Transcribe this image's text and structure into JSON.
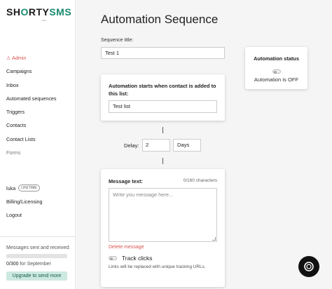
{
  "brand": {
    "name_a": "SH",
    "name_b": "RTY",
    "name_c": "SMS",
    "sub": "beta"
  },
  "sidebar": {
    "items": [
      {
        "label": "⚠ Admin"
      },
      {
        "label": "Campaigns"
      },
      {
        "label": "Inbox"
      },
      {
        "label": "Automated sequences"
      },
      {
        "label": "Triggers"
      },
      {
        "label": "Contacts"
      },
      {
        "label": "Contact Lists"
      },
      {
        "label": "Forms"
      }
    ],
    "user": {
      "name": "luka",
      "badge": "LIFETIME"
    },
    "account_items": [
      {
        "label": "Billing/Licensing"
      },
      {
        "label": "Logout"
      }
    ],
    "usage": {
      "label": "Messages sent and received:",
      "count": "0/300",
      "period": "for September",
      "progress": 0,
      "upgrade_label": "Upgrade to send more"
    }
  },
  "main": {
    "title": "Automation Sequence",
    "sequence_title_label": "Sequence title:",
    "sequence_title_value": "Test 1",
    "starts_label": "Automation starts when contact is added to this list:",
    "list_value": "Test list",
    "status": {
      "title": "Automation status",
      "text": "Automation is OFF"
    },
    "delay": {
      "label": "Delay:",
      "value": "2",
      "unit": "Days"
    },
    "message": {
      "label": "Message text:",
      "count": "0/160 characters",
      "placeholder": "Write you message here...",
      "delete_label": "Delete message",
      "track_label": "Track clicks",
      "track_help": "Links will be replaced with unique tracking URLs."
    }
  },
  "colors": {
    "brand": "#1a8a6e",
    "danger": "#d9534f"
  }
}
